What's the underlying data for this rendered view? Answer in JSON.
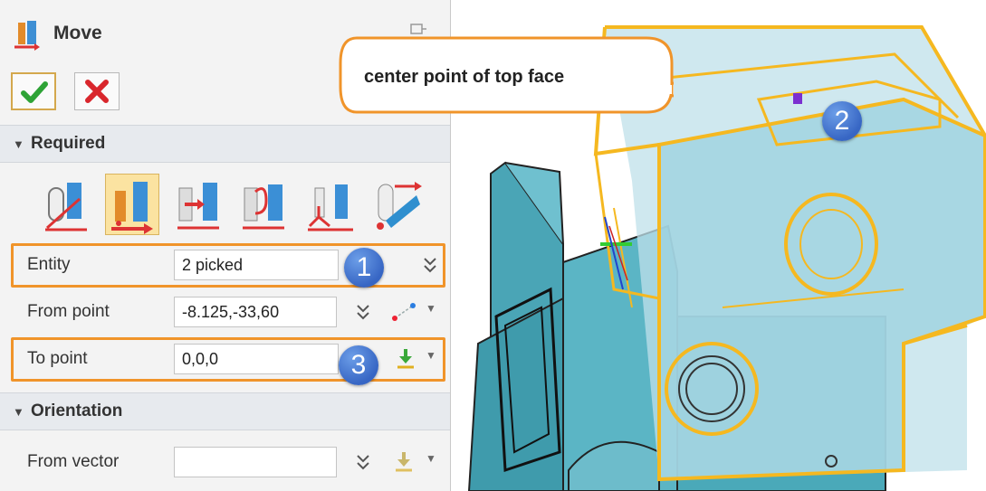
{
  "panel": {
    "title": "Move",
    "ok_icon": "checkmark-icon",
    "cancel_icon": "x-icon",
    "required_section": "Required",
    "orientation_section": "Orientation",
    "modes": [
      "dynamic-move-icon",
      "point-to-point-move-icon",
      "move-along-direction-icon",
      "rotate-move-icon",
      "align-move-icon",
      "path-move-icon"
    ],
    "selected_mode": 1,
    "entity": {
      "label": "Entity",
      "value": "2 picked"
    },
    "from_point": {
      "label": "From point",
      "value": "-8.125,-33,60"
    },
    "to_point": {
      "label": "To point",
      "value": "0,0,0"
    },
    "from_vector": {
      "label": "From vector",
      "value": ""
    }
  },
  "annotations": {
    "step1": "1",
    "step2": "2",
    "step3": "3",
    "callout": "center point of top face"
  },
  "colors": {
    "highlight": "#f0942a",
    "badge": "#3f6fd0",
    "model": "#63b8c7",
    "selection": "#f5b820"
  }
}
